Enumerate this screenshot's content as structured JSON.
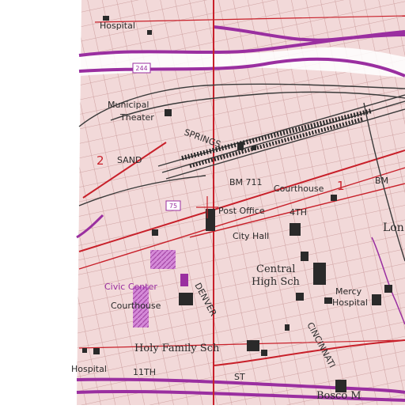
{
  "labels": {
    "hospital_top": "Hospital",
    "municipal_theater_1": "Municipal",
    "municipal_theater_2": "Theater",
    "sand": "SAND",
    "springs": "SPRINGS",
    "bm_711": "BM 711",
    "courthouse_top": "Courthouse",
    "bm_right": "BM",
    "post_office": "Post Office",
    "fourth_st": "4TH",
    "city_hall": "City Hall",
    "lon": "Lon",
    "central": "Central",
    "high_sch": "High Sch",
    "civic_center": "Civic Center",
    "courthouse_lower": "Courthouse",
    "mercy_hospital_1": "Mercy",
    "mercy_hospital_2": "Hospital",
    "holy_family_sch": "Holy Family Sch",
    "hospital_lower": "Hospital",
    "eleventh": "11TH",
    "st_bottom": "ST",
    "denver": "DENVER",
    "cincinnati": "CINCINNATI",
    "number_2": "2",
    "number_1": "1",
    "route_244": "244",
    "route_75": "75",
    "bottom_fragment": "Bosco M"
  },
  "colors": {
    "background": "#f3dede",
    "grid_light": "#e7c4c4",
    "street": "#c98f8f",
    "street_dark": "#b07070",
    "highway_purple": "#9a2fa0",
    "red_line": "#c8202a",
    "railroad": "#3a3a3a",
    "building": "#2a2a2a",
    "river": "#ffffff"
  }
}
